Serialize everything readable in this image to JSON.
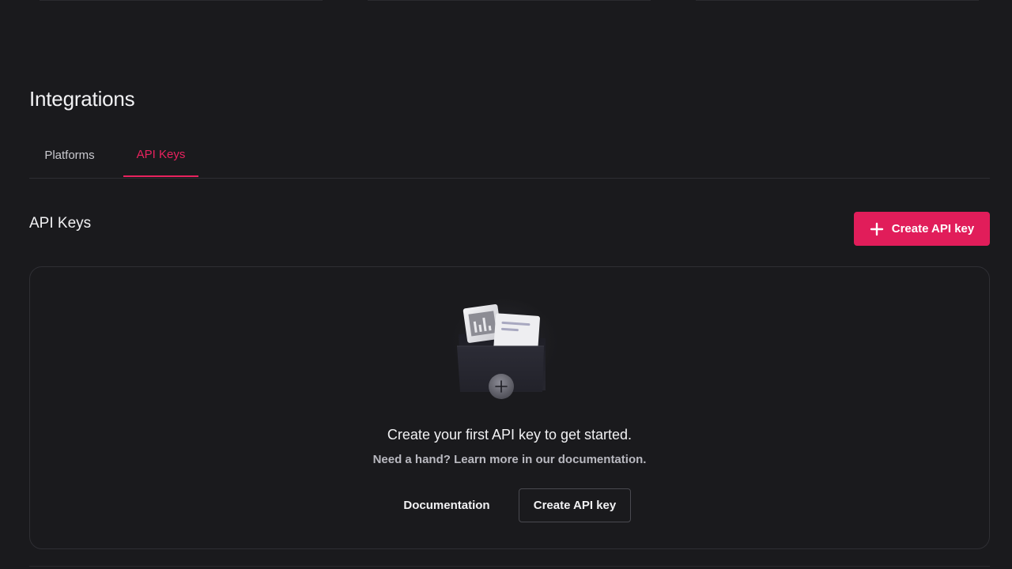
{
  "page": {
    "title": "Integrations"
  },
  "tabs": [
    {
      "label": "Platforms",
      "active": false
    },
    {
      "label": "API Keys",
      "active": true
    }
  ],
  "section": {
    "title": "API Keys",
    "create_button_label": "Create API key",
    "create_button_icon": "plus-icon"
  },
  "empty_state": {
    "illustration": "folder-documents-icon",
    "heading": "Create your first API key to get started.",
    "subtext": "Need a hand? Learn more in our documentation.",
    "documentation_label": "Documentation",
    "create_label": "Create API key"
  },
  "colors": {
    "background": "#1a1a1d",
    "accent": "#e11d5a",
    "border": "#2f2f34"
  }
}
